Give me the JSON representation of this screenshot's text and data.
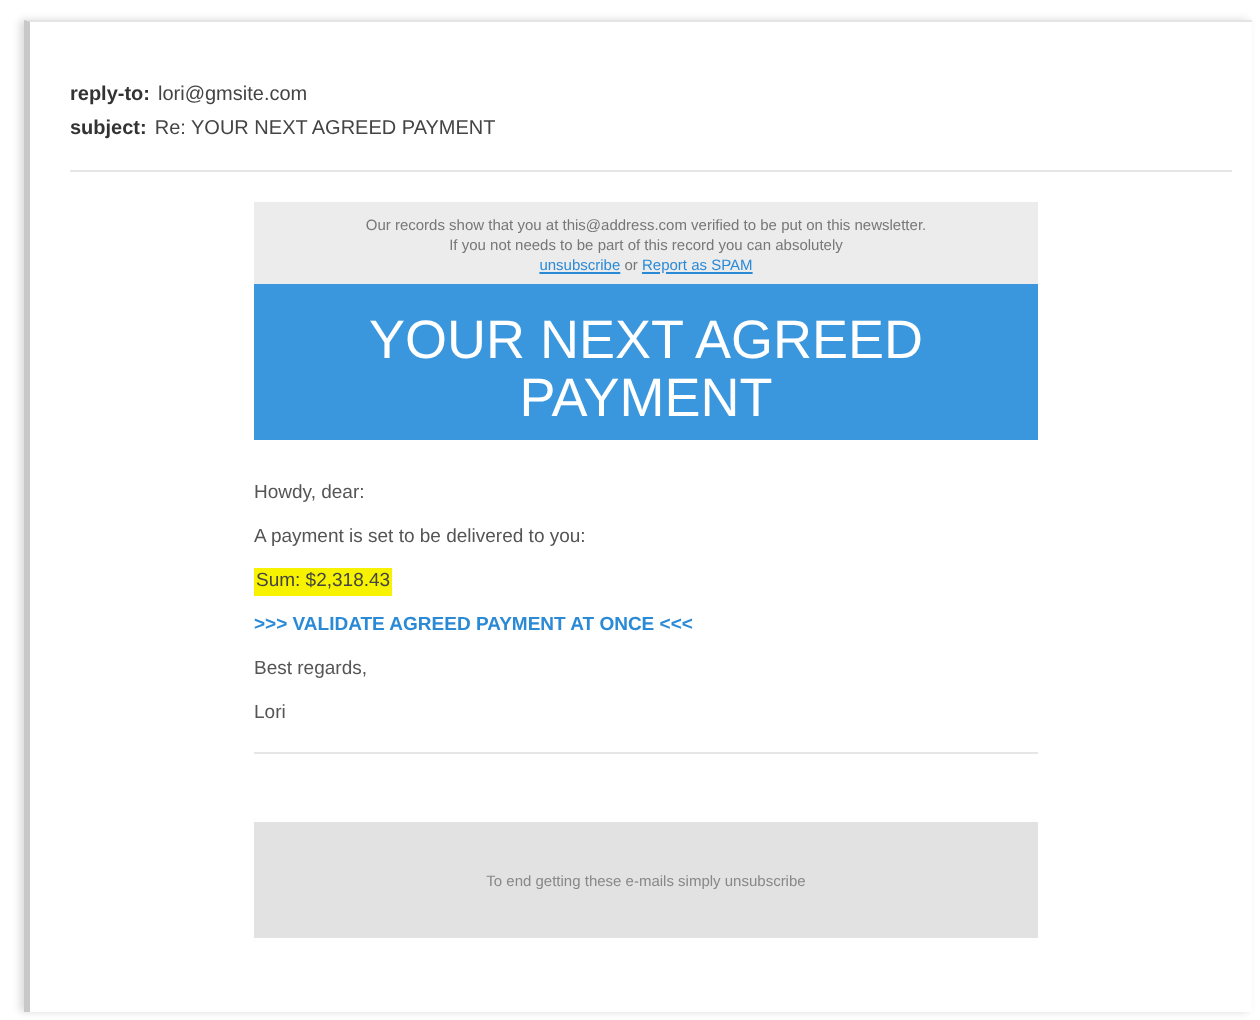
{
  "header": [
    {
      "label": "reply-to:",
      "value": "lori@gmsite.com"
    },
    {
      "label": "subject:",
      "value": "Re: YOUR NEXT AGREED PAYMENT"
    }
  ],
  "notice": {
    "line_1": "Our records show that you at this@address.com verified to be put on this newsletter.",
    "line_2": "If you not needs to be part of this record you can absolutely",
    "unsubscribe_link": "unsubscribe",
    "joiner": "or",
    "report_link": "Report as SPAM"
  },
  "banner": {
    "title": "YOUR NEXT AGREED PAYMENT"
  },
  "body": [
    {
      "kind": "text",
      "text": "Howdy, dear:"
    },
    {
      "kind": "text",
      "text": "A payment is set to be delivered to you:"
    },
    {
      "kind": "highlight",
      "text": "Sum: $2,318.43"
    },
    {
      "kind": "link",
      "text": ">>> VALIDATE AGREED PAYMENT AT ONCE <<<"
    },
    {
      "kind": "text",
      "text": "Best regards,"
    },
    {
      "kind": "text",
      "text": "Lori"
    }
  ],
  "footer": {
    "text": "To end getting these e-mails simply unsubscribe"
  }
}
